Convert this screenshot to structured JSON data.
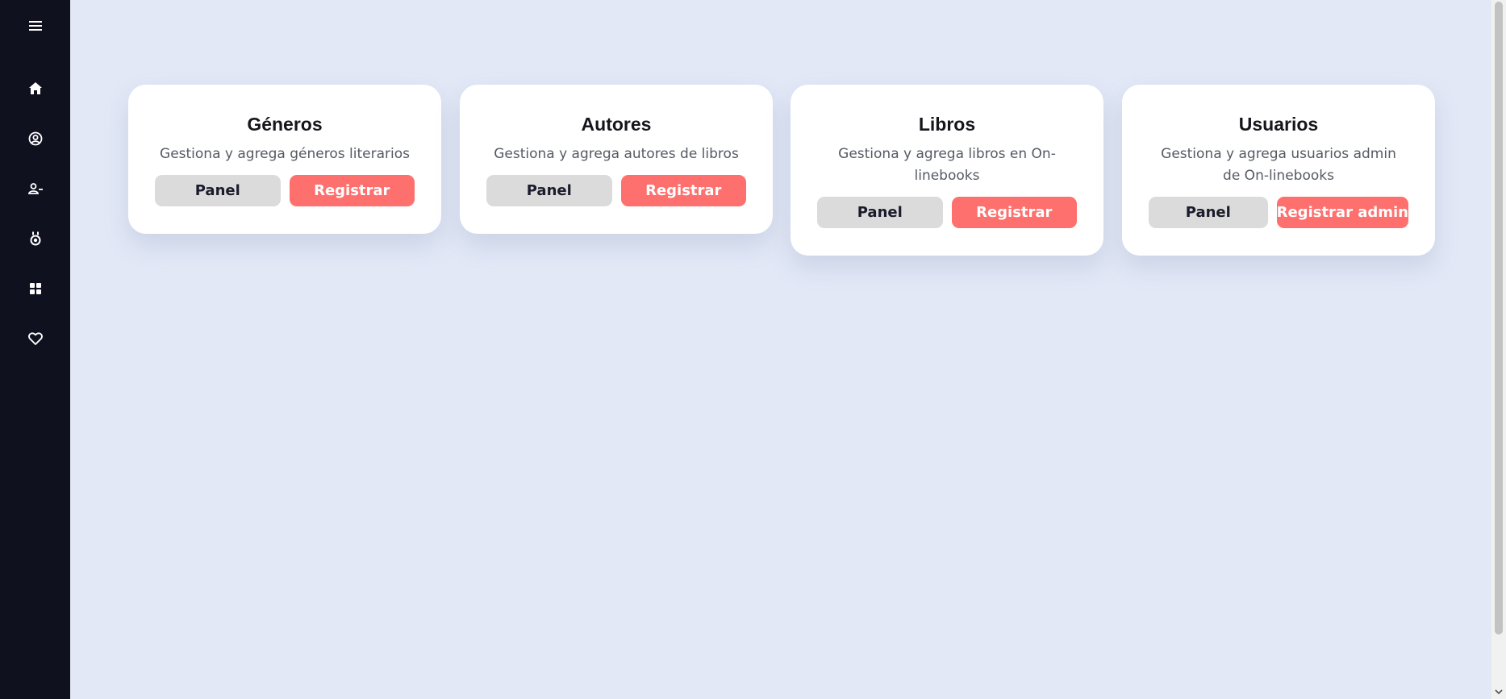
{
  "sidebar": {
    "items": [
      {
        "icon": "home-icon"
      },
      {
        "icon": "user-circle-icon"
      },
      {
        "icon": "user-minus-icon"
      },
      {
        "icon": "medal-icon"
      },
      {
        "icon": "grid-icon"
      },
      {
        "icon": "heart-icon"
      }
    ],
    "colors": {
      "background": "#10111f",
      "icon": "#ffffff"
    }
  },
  "cards": [
    {
      "title": "Géneros",
      "description": "Gestiona y agrega géneros literarios",
      "panel_label": "Panel",
      "register_label": "Registrar"
    },
    {
      "title": "Autores",
      "description": "Gestiona y agrega autores de libros",
      "panel_label": "Panel",
      "register_label": "Registrar"
    },
    {
      "title": "Libros",
      "description": "Gestiona y agrega libros en On-linebooks",
      "panel_label": "Panel",
      "register_label": "Registrar"
    },
    {
      "title": "Usuarios",
      "description": "Gestiona y agrega usuarios admin de On-linebooks",
      "panel_label": "Panel",
      "register_label": "Registrar admin"
    }
  ],
  "colors": {
    "page_background": "#e2e8f6",
    "card_background": "#ffffff",
    "panel_button": "#dbdbdb",
    "register_button": "#fe706e"
  }
}
